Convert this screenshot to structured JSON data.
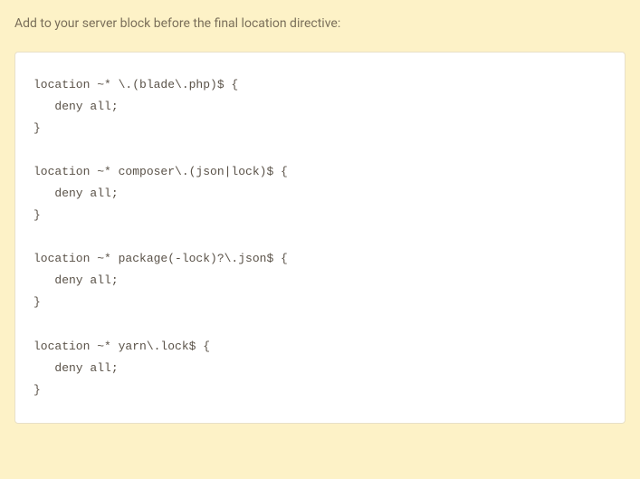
{
  "intro": "Add to your server block before the final location directive:",
  "code": "location ~* \\.(blade\\.php)$ {\n   deny all;\n}\n\nlocation ~* composer\\.(json|lock)$ {\n   deny all;\n}\n\nlocation ~* package(-lock)?\\.json$ {\n   deny all;\n}\n\nlocation ~* yarn\\.lock$ {\n   deny all;\n}"
}
